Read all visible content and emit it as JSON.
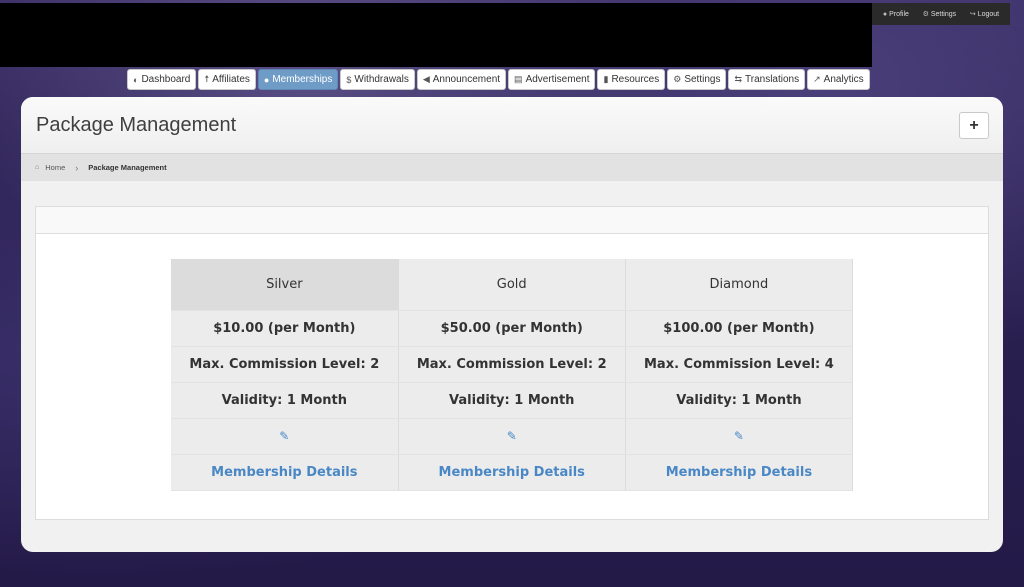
{
  "user_menu": {
    "profile": "Profile",
    "settings": "Settings",
    "logout": "Logout"
  },
  "nav": [
    {
      "label": "Dashboard",
      "icon": "dashboard-icon",
      "glyph": "◐"
    },
    {
      "label": "Affiliates",
      "icon": "person-icon",
      "glyph": "☨"
    },
    {
      "label": "Memberships",
      "icon": "user-icon",
      "glyph": "●",
      "active": true
    },
    {
      "label": "Withdrawals",
      "icon": "dollar-icon",
      "glyph": "$"
    },
    {
      "label": "Announcement",
      "icon": "bullhorn-icon",
      "glyph": "◀"
    },
    {
      "label": "Advertisement",
      "icon": "film-icon",
      "glyph": "▤"
    },
    {
      "label": "Resources",
      "icon": "file-icon",
      "glyph": "▮"
    },
    {
      "label": "Settings",
      "icon": "gears-icon",
      "glyph": "⚙"
    },
    {
      "label": "Translations",
      "icon": "translate-icon",
      "glyph": "⇆"
    },
    {
      "label": "Analytics",
      "icon": "chart-icon",
      "glyph": "↗"
    }
  ],
  "page": {
    "title": "Package Management",
    "add_label": "+"
  },
  "breadcrumb": {
    "home": "Home",
    "current": "Package Management"
  },
  "packages": [
    {
      "name": "Silver",
      "price": "$10.00 (per Month)",
      "commission": "Max. Commission Level: 2",
      "validity": "Validity: 1 Month",
      "details": "Membership Details"
    },
    {
      "name": "Gold",
      "price": "$50.00 (per Month)",
      "commission": "Max. Commission Level: 2",
      "validity": "Validity: 1 Month",
      "details": "Membership Details"
    },
    {
      "name": "Diamond",
      "price": "$100.00 (per Month)",
      "commission": "Max. Commission Level: 4",
      "validity": "Validity: 1 Month",
      "details": "Membership Details"
    }
  ],
  "colors": {
    "accent": "#4a88c5",
    "active_nav": "#6f9bc7"
  }
}
